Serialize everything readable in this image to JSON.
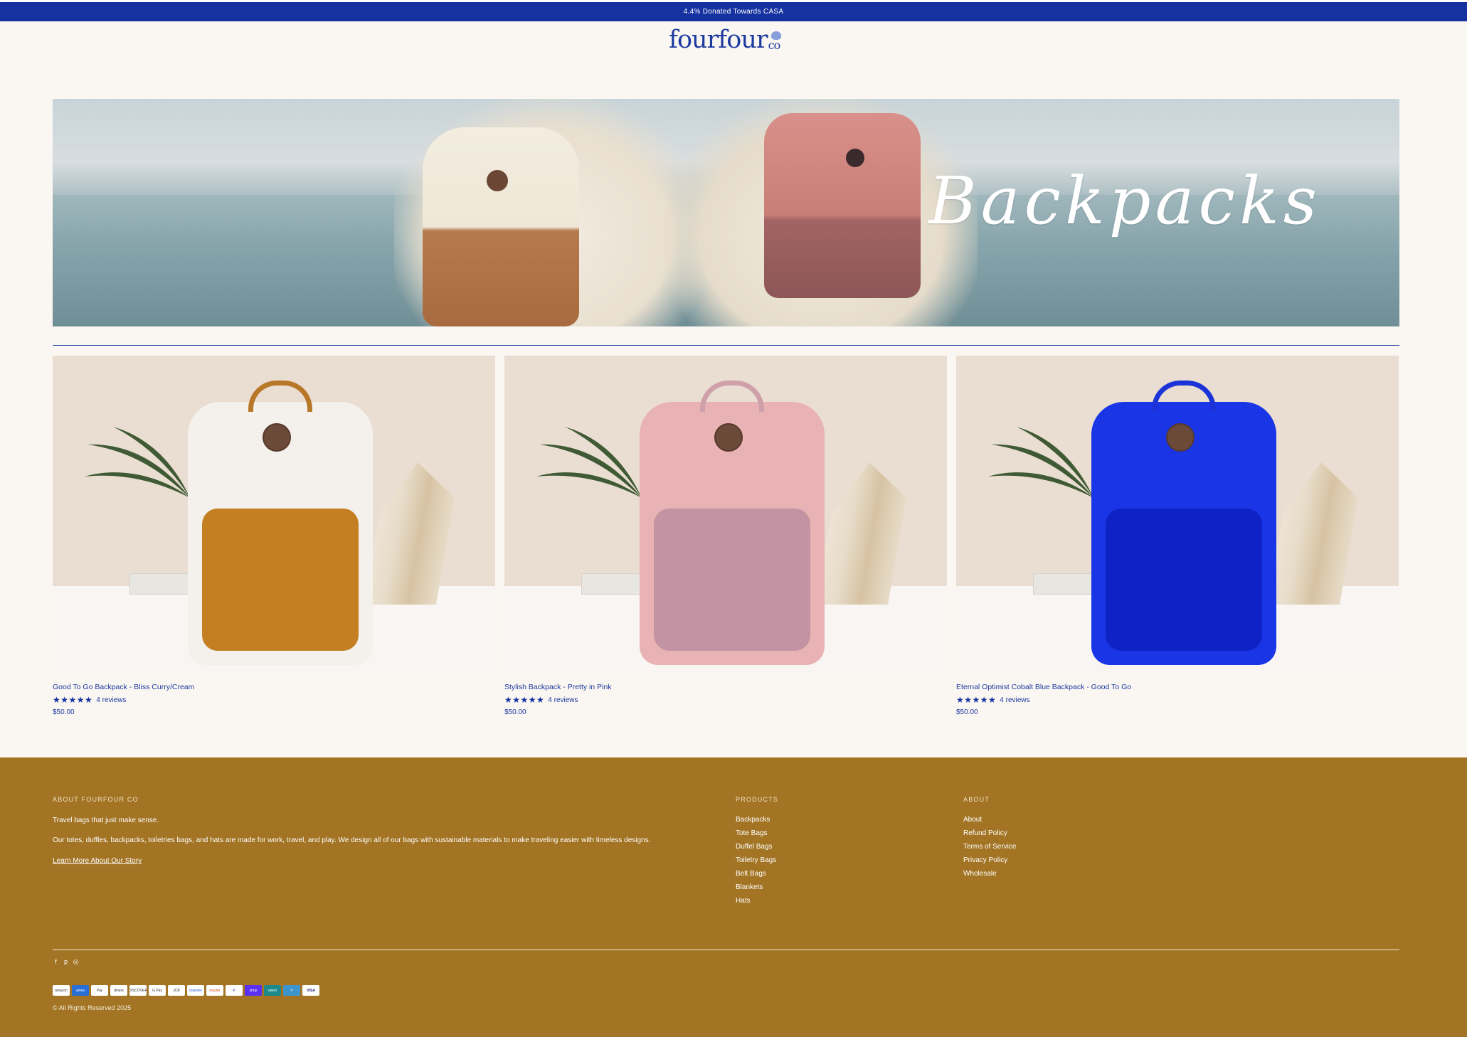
{
  "announcement": "4.4% Donated Towards CASA",
  "brand": {
    "logo_text": "fourfour",
    "logo_suffix": "co"
  },
  "hero": {
    "title": "Backpacks"
  },
  "products": [
    {
      "title": "Good To Go Backpack - Bliss Curry/Cream",
      "stars": "★★★★★",
      "reviews": "4 reviews",
      "price": "$50.00",
      "bag_top": "#f4f1ec",
      "bag_front": "#c47f22",
      "handle": "#b8782a"
    },
    {
      "title": "Stylish Backpack - Pretty in Pink",
      "stars": "★★★★★",
      "reviews": "4 reviews",
      "price": "$50.00",
      "bag_top": "#e9b2b4",
      "bag_front": "#c293a2",
      "handle": "#cfa0aa"
    },
    {
      "title": "Eternal Optimist Cobalt Blue Backpack - Good To Go",
      "stars": "★★★★★",
      "reviews": "4 reviews",
      "price": "$50.00",
      "bag_top": "#1a35e6",
      "bag_front": "#0f22c6",
      "handle": "#1c33d8"
    }
  ],
  "footer": {
    "about": {
      "heading": "ABOUT FOURFOUR CO",
      "tagline": "Travel bags that just make sense.",
      "description": "Our totes, duffles, backpacks, toiletries bags, and hats are made for work, travel, and play. We design all of our bags with sustainable materials to make traveling easier with timeless designs.",
      "link": "Learn More About Our Story"
    },
    "products": {
      "heading": "PRODUCTS",
      "items": [
        "Backpacks",
        "Tote Bags",
        "Duffel Bags",
        "Toiletry Bags",
        "Belt Bags",
        "Blankets",
        "Hats"
      ]
    },
    "about_menu": {
      "heading": "ABOUT",
      "items": [
        "About",
        "Refund Policy",
        "Terms of Service",
        "Privacy Policy",
        "Wholesale"
      ]
    },
    "social": [
      "facebook-icon",
      "pinterest-icon",
      "instagram-icon"
    ],
    "payments": [
      "amazon",
      "amex",
      "Pay",
      "diners",
      "DISCOVER",
      "G Pay",
      "JCB",
      "maestro",
      "master",
      "P",
      "shop",
      "union",
      "V",
      "VISA"
    ],
    "copyright": "© All Rights Reserved 2025"
  },
  "colors": {
    "brand_blue": "#1632a0",
    "footer_bg": "#a27424",
    "page_bg": "#faf6f1"
  }
}
